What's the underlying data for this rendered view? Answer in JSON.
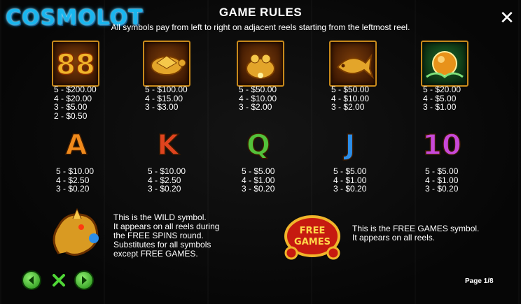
{
  "brand": "COSMOLOT",
  "title": "GAME RULES",
  "subtitle": "All symbols pay from left to right on adjacent reels starting from the leftmost reel.",
  "symbols": [
    {
      "icon": "lucky-88-icon",
      "pays": [
        "5 - $200.00",
        "4 - $20.00",
        "3 - $5.00",
        "2 - $0.50"
      ]
    },
    {
      "icon": "golden-turtle-icon",
      "pays": [
        "5 - $100.00",
        "4 - $15.00",
        "3 - $3.00"
      ]
    },
    {
      "icon": "golden-toad-icon",
      "pays": [
        "5 - $50.00",
        "4 - $10.00",
        "3 - $2.00"
      ]
    },
    {
      "icon": "golden-koi-fish-icon",
      "pays": [
        "5 - $50.00",
        "4 - $10.00",
        "3 - $2.00"
      ]
    },
    {
      "icon": "jade-orb-icon",
      "pays": [
        "5 - $20.00",
        "4 - $5.00",
        "3 - $1.00"
      ]
    },
    {
      "letter": "A",
      "color": "#f08a1c",
      "pays": [
        "5 - $10.00",
        "4 - $2.50",
        "3 - $0.20"
      ]
    },
    {
      "letter": "K",
      "color": "#e0441e",
      "pays": [
        "5 - $10.00",
        "4 - $2.50",
        "3 - $0.20"
      ]
    },
    {
      "letter": "Q",
      "color": "#53c13a",
      "pays": [
        "5 - $5.00",
        "4 - $1.00",
        "3 - $0.20"
      ]
    },
    {
      "letter": "J",
      "color": "#2c8ee8",
      "pays": [
        "5 - $5.00",
        "4 - $1.00",
        "3 - $0.20"
      ]
    },
    {
      "letter": "10",
      "color": "#c848d8",
      "pays": [
        "5 - $5.00",
        "4 - $1.00",
        "3 - $0.20"
      ]
    }
  ],
  "wild": {
    "icon": "golden-dragon-icon",
    "lines": [
      "This is the WILD symbol.",
      "It appears on all reels during",
      "the FREE SPINS round.",
      "Substitutes for all symbols",
      "except FREE GAMES."
    ]
  },
  "free_games": {
    "icon": "free-games-icon",
    "badge_top": "FREE",
    "badge_bottom": "GAMES",
    "lines": [
      "This is the FREE GAMES symbol.",
      "It appears on all reels."
    ]
  },
  "nav": {
    "prev_icon": "arrow-left-icon",
    "close_icon": "close-x-icon",
    "next_icon": "arrow-right-icon"
  },
  "page": "Page 1/8",
  "colors": {
    "accent": "#19b6ef",
    "gold": "#c98a1b",
    "nav_green": "#2fb41f"
  }
}
